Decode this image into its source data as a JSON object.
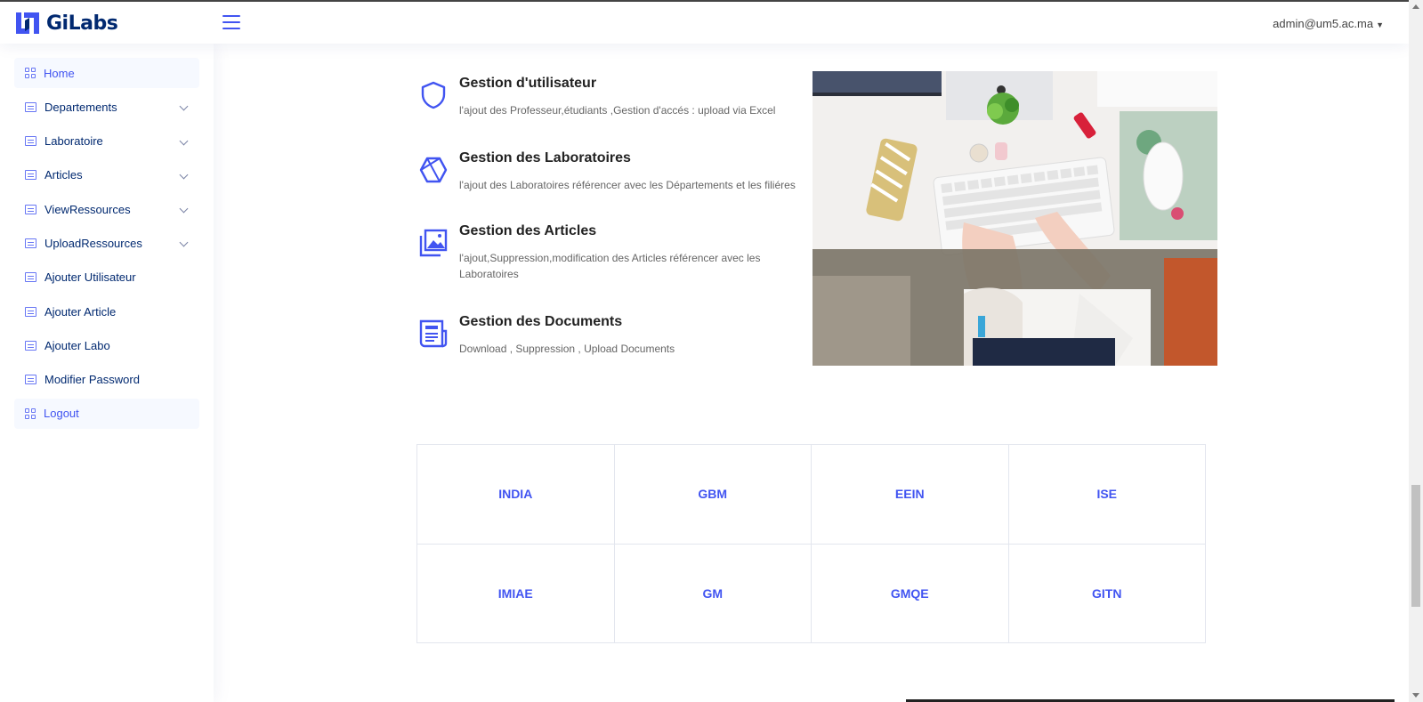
{
  "header": {
    "brand": "GiLabs",
    "user_email": "admin@um5.ac.ma"
  },
  "sidebar": {
    "items": [
      {
        "label": "Home",
        "icon": "grid-icon",
        "active": true,
        "expandable": false
      },
      {
        "label": "Departements",
        "icon": "menu-icon",
        "expandable": true
      },
      {
        "label": "Laboratoire",
        "icon": "menu-icon",
        "expandable": true
      },
      {
        "label": "Articles",
        "icon": "layout-icon",
        "expandable": true
      },
      {
        "label": "ViewRessources",
        "icon": "menu-icon",
        "expandable": true
      },
      {
        "label": "UploadRessources",
        "icon": "menu-icon",
        "expandable": true
      },
      {
        "label": "Ajouter Utilisateur",
        "icon": "list-icon",
        "expandable": false
      },
      {
        "label": "Ajouter Article",
        "icon": "list-icon",
        "expandable": false
      },
      {
        "label": "Ajouter Labo",
        "icon": "list-icon",
        "expandable": false
      },
      {
        "label": "Modifier Password",
        "icon": "list-icon",
        "expandable": false
      },
      {
        "label": "Logout",
        "icon": "grid-icon",
        "active": true,
        "expandable": false
      }
    ]
  },
  "features": [
    {
      "title": "Gestion d'utilisateur",
      "description": "l'ajout des Professeur,étudiants ,Gestion d'accés : upload via Excel",
      "icon": "shield-icon"
    },
    {
      "title": "Gestion des Laboratoires",
      "description": "l'ajout des Laboratoires référencer avec les Départements et les filiéres",
      "icon": "hexagon-icon"
    },
    {
      "title": "Gestion des Articles",
      "description": "l'ajout,Suppression,modification des Articles référencer avec les Laboratoires",
      "icon": "images-icon"
    },
    {
      "title": "Gestion des Documents",
      "description": "Download , Suppression , Upload Documents",
      "icon": "newspaper-icon"
    }
  ],
  "departments": [
    "INDIA",
    "GBM",
    "EEIN",
    "ISE",
    "IMIAE",
    "GM",
    "GMQE",
    "GITN"
  ],
  "colors": {
    "accent": "#4154f1",
    "nav_text": "#012970"
  }
}
